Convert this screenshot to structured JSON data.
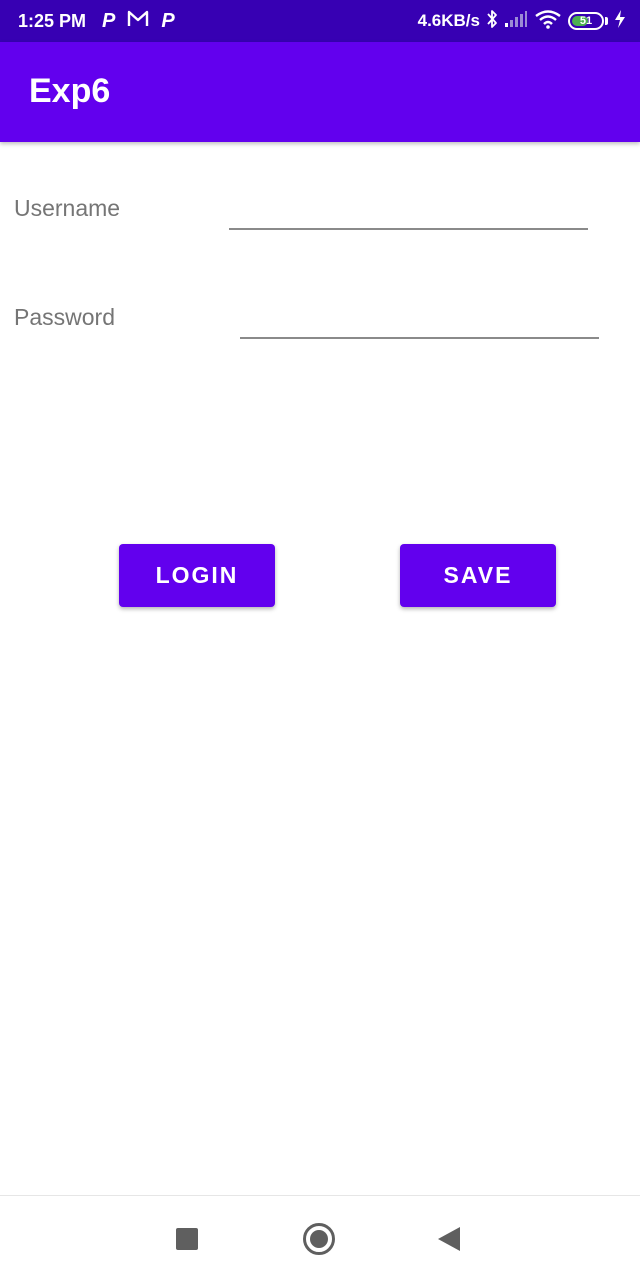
{
  "status_bar": {
    "time": "1:25 PM",
    "notification_icons": [
      "P",
      "M",
      "P"
    ],
    "net_speed": "4.6KB/s",
    "battery_level": "51",
    "icons": [
      "bluetooth-icon",
      "signal-icon",
      "wifi-icon",
      "battery-icon",
      "charging-icon"
    ],
    "background_color": "#3700b3"
  },
  "app_bar": {
    "title": "Exp6",
    "background_color": "#6200ee"
  },
  "form": {
    "username": {
      "label": "Username",
      "value": ""
    },
    "password": {
      "label": "Password",
      "value": ""
    }
  },
  "buttons": {
    "login_label": "LOGIN",
    "save_label": "SAVE",
    "color": "#6200ee"
  },
  "nav_bar": {
    "icons": [
      "recent-apps-icon",
      "home-icon",
      "back-icon"
    ]
  }
}
